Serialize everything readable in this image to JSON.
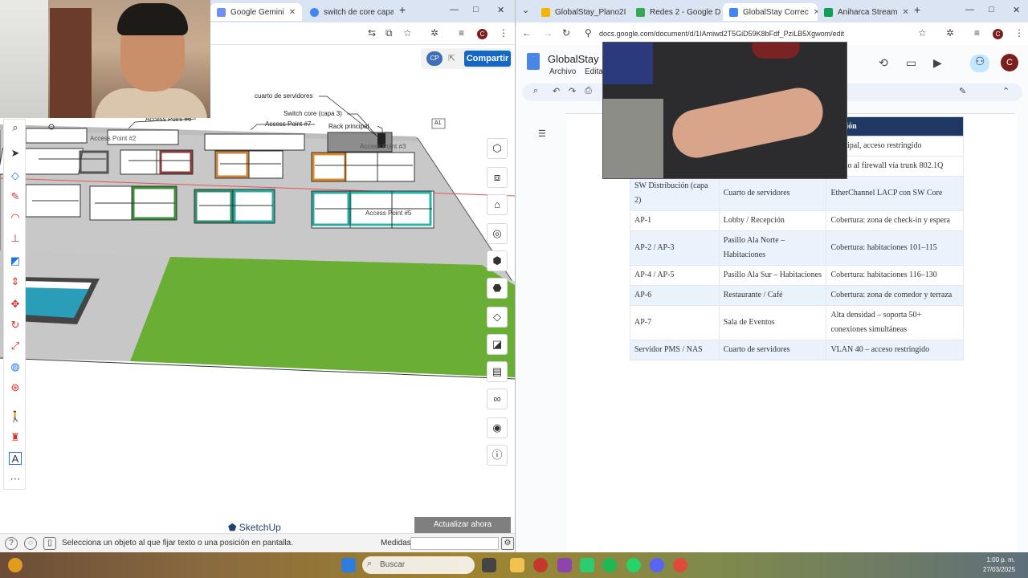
{
  "left_browser": {
    "tabs": [
      {
        "label": "Google Gemini",
        "icon": "gemini-icon",
        "color": "#6f8ff5"
      },
      {
        "label": "switch de core capa",
        "icon": "google-icon",
        "color": "#4285f4"
      }
    ],
    "window_controls": {
      "minimize": "—",
      "maximize": "□",
      "close": "✕"
    }
  },
  "sketchup": {
    "share_label": "Compartir",
    "avatar_initials": "CP",
    "update_label": "Actualizar ahora",
    "logo_text": "SketchUp",
    "status_hint": "Selecciona un objeto al que fijar texto o una posición en pantalla.",
    "measures_label": "Medidas",
    "labels": {
      "cuarto": "cuarto de servidores",
      "switch_core": "Switch core (capa 3)",
      "ap7": "Access Point #7",
      "ap6": "Access Point #6",
      "ap2": "Access Point #2",
      "rack": "Rack principal",
      "ap3": "Access Point #3",
      "ap5": "Access Point #5",
      "a1": "A1"
    }
  },
  "right_browser": {
    "tabs": [
      {
        "label": "GlobalStay_Plano2I",
        "icon": "slides-icon",
        "color": "#f4b400"
      },
      {
        "label": "Redes 2 - Google D",
        "icon": "drive-icon",
        "color": "#34a853"
      },
      {
        "label": "GlobalStay Correc",
        "icon": "docs-icon",
        "color": "#4285f4"
      },
      {
        "label": "Aniharca Stream",
        "icon": "sheets-icon",
        "color": "#0f9d58"
      }
    ],
    "url": "docs.google.com/document/d/1IAmiwd2T5GiD59K8bFdf_PziLB5Xgwom/edit"
  },
  "docs": {
    "title": "GlobalStay C",
    "menu": [
      "Archivo",
      "Edita"
    ],
    "avatar_initial": "C",
    "table": {
      "header_last": "rvación",
      "rows": [
        {
          "c1": "",
          "c2": "",
          "c3": "principal, acceso restringido"
        },
        {
          "c1": "",
          "c2": "",
          "c3": "ectado al firewall vía trunk 802.1Q"
        },
        {
          "c1": "SW Distribución (capa 2)",
          "c2": "Cuarto de servidores",
          "c3": "EtherChannel LACP con SW Core"
        },
        {
          "c1": "AP-1",
          "c2": "Lobby / Recepción",
          "c3": "Cobertura: zona de check-in y espera"
        },
        {
          "c1": "AP-2 / AP-3",
          "c2": "Pasillo Ala Norte – Habitaciones",
          "c3": "Cobertura: habitaciones 101–115"
        },
        {
          "c1": "AP-4 / AP-5",
          "c2": "Pasillo Ala Sur – Habitaciones",
          "c3": "Cobertura: habitaciones 116–130"
        },
        {
          "c1": "AP-6",
          "c2": "Restaurante / Café",
          "c3": "Cobertura: zona de comedor y terraza"
        },
        {
          "c1": "AP-7",
          "c2": "Sala de Eventos",
          "c3": "Alta densidad – soporta 50+ conexiones simultáneas"
        },
        {
          "c1": "Servidor PMS / NAS",
          "c2": "Cuarto de servidores",
          "c3": "VLAN 40 – acceso restringido"
        }
      ]
    }
  },
  "taskbar": {
    "search_placeholder": "Buscar",
    "time": "1:00 p. m.",
    "date": "27/03/2025"
  }
}
